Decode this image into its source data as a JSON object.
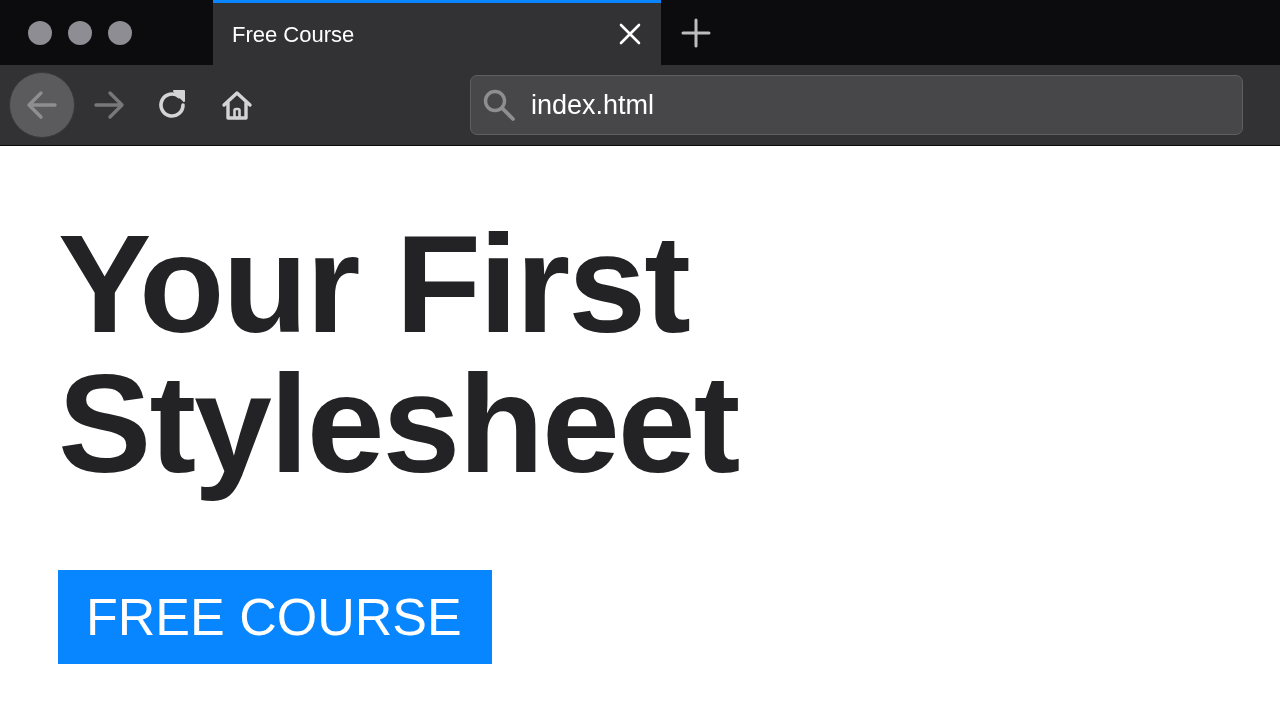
{
  "tabs": [
    {
      "title": "Free Course",
      "selected": true
    }
  ],
  "toolbar": {
    "back_button": {
      "hovered": true
    },
    "forward_button": {
      "disabled": true
    }
  },
  "address_bar": {
    "value": "index.html"
  },
  "page": {
    "heading": "Your First Stylesheet",
    "button": "FREE COURSE"
  }
}
